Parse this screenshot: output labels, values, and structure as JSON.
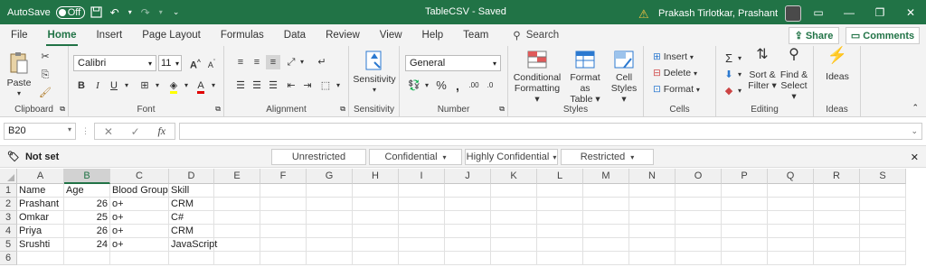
{
  "titlebar": {
    "autosave_label": "AutoSave",
    "autosave_state": "Off",
    "doc_title": "TableCSV  -  Saved",
    "user_name": "Prakash Tirlotkar, Prashant"
  },
  "tabs": [
    "File",
    "Home",
    "Insert",
    "Page Layout",
    "Formulas",
    "Data",
    "Review",
    "View",
    "Help",
    "Team"
  ],
  "search_label": "Search",
  "share_label": "Share",
  "comments_label": "Comments",
  "ribbon": {
    "clipboard": {
      "paste": "Paste",
      "label": "Clipboard"
    },
    "font": {
      "name": "Calibri",
      "size": "11",
      "label": "Font",
      "bold": "B",
      "italic": "I",
      "underline": "U",
      "grow": "A",
      "shrink": "A"
    },
    "alignment": {
      "label": "Alignment"
    },
    "sensitivity": {
      "btn": "Sensitivity",
      "label": "Sensitivity"
    },
    "number": {
      "format": "General",
      "label": "Number"
    },
    "styles": {
      "conditional_1": "Conditional",
      "conditional_2": "Formatting",
      "table_1": "Format as",
      "table_2": "Table",
      "cell_1": "Cell",
      "cell_2": "Styles",
      "label": "Styles"
    },
    "cells": {
      "insert": "Insert",
      "delete": "Delete",
      "format": "Format",
      "label": "Cells"
    },
    "editing": {
      "sort_1": "Sort &",
      "sort_2": "Filter",
      "find_1": "Find &",
      "find_2": "Select",
      "label": "Editing"
    },
    "ideas": {
      "btn": "Ideas",
      "label": "Ideas"
    }
  },
  "namebox": "B20",
  "fx_label": "fx",
  "sensitivity_bar": {
    "status": "Not set",
    "options": [
      "Unrestricted",
      "Confidential",
      "Highly Confidential",
      "Restricted"
    ]
  },
  "columns": [
    "A",
    "B",
    "C",
    "D",
    "E",
    "F",
    "G",
    "H",
    "I",
    "J",
    "K",
    "L",
    "M",
    "N",
    "O",
    "P",
    "Q",
    "R",
    "S"
  ],
  "rows": [
    "1",
    "2",
    "3",
    "4",
    "5",
    "6"
  ],
  "cells": [
    [
      "Name",
      "Age",
      "Blood Group",
      "Skill"
    ],
    [
      "Prashant",
      "26",
      "o+",
      "CRM"
    ],
    [
      "Omkar",
      "25",
      "o+",
      "C#"
    ],
    [
      "Priya",
      "26",
      "o+",
      "CRM"
    ],
    [
      "Srushti",
      "24",
      "o+",
      "JavaScript"
    ],
    [
      "",
      "",
      "",
      ""
    ]
  ],
  "colors": {
    "accent": "#217346"
  }
}
